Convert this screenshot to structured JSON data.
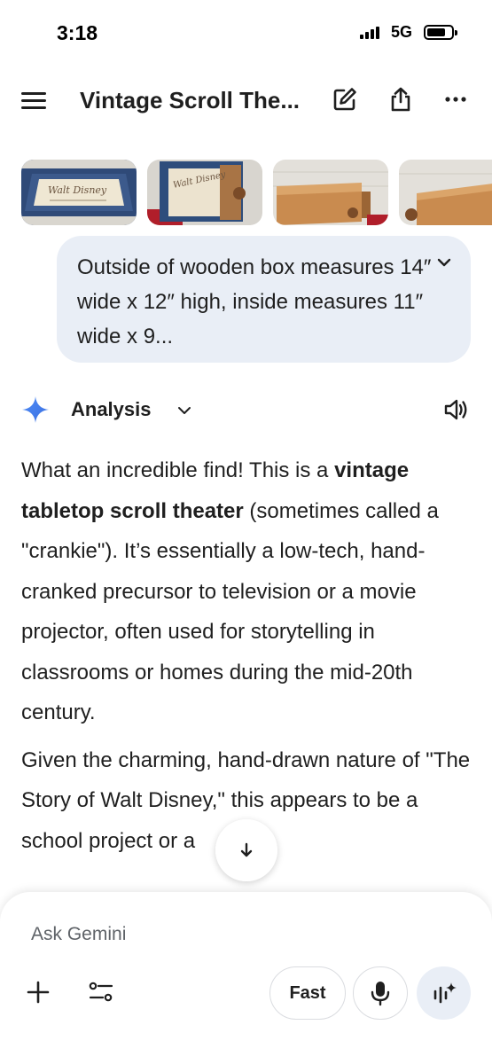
{
  "status_bar": {
    "time": "3:18",
    "network": "5G"
  },
  "header": {
    "title": "Vintage Scroll The..."
  },
  "thumbnails": [
    {
      "label": "Walt Disney"
    },
    {
      "label": "Walt Disney"
    },
    {
      "label": ""
    },
    {
      "label": ""
    }
  ],
  "prompt": {
    "text": "Outside of wooden box measures 14″ wide x 12″ high, inside measures 11″ wide x 9..."
  },
  "response_header": {
    "label": "Analysis"
  },
  "response": {
    "p1_a": "What an incredible find! This is a ",
    "p1_bold": "vintage tabletop scroll theater",
    "p1_b": " (sometimes called a \"crankie\"). It’s essentially a low-tech, hand-cranked precursor to television or a movie projector, often used for storytelling in classrooms or homes during the mid-20th century.",
    "p2": "Given the charming, hand-drawn nature of \"The Story of Walt Disney,\" this appears to be a school project or a"
  },
  "composer": {
    "placeholder": "Ask Gemini",
    "mode_label": "Fast"
  },
  "colors": {
    "accent_blue": "#4285f4",
    "bubble_bg": "#e9eef6",
    "text": "#1f1f1f"
  }
}
